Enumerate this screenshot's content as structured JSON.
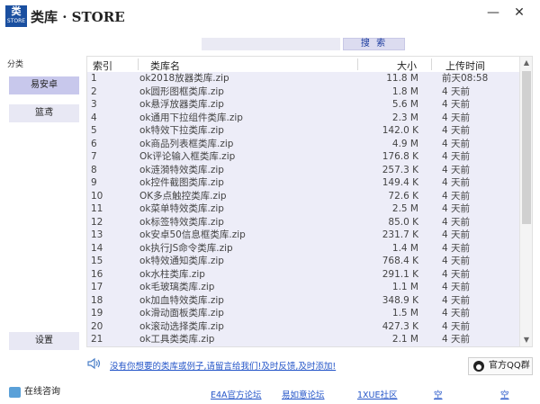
{
  "app": {
    "logo_text": "类",
    "logo_sub": "STORE",
    "title": "类库 · STORE",
    "minimize": "—",
    "close": "✕"
  },
  "search": {
    "value": "",
    "placeholder": "",
    "button_label": "搜 索"
  },
  "sidebar": {
    "category_label": "分类",
    "items": [
      {
        "label": "易安卓",
        "active": true
      },
      {
        "label": "篮鸢",
        "active": false
      }
    ],
    "settings_label": "设置"
  },
  "table": {
    "columns": [
      "索引",
      "类库名",
      "大小",
      "上传时间"
    ],
    "rows": [
      [
        "1",
        "ok2018放器类库.zip",
        "11.8 M",
        "前天08:58"
      ],
      [
        "2",
        "ok圆形图框类库.zip",
        "1.8 M",
        "4 天前"
      ],
      [
        "3",
        "ok悬浮放器类库.zip",
        "5.6 M",
        "4 天前"
      ],
      [
        "4",
        "ok通用下拉组件类库.zip",
        "2.3 M",
        "4 天前"
      ],
      [
        "5",
        "ok特效下拉类库.zip",
        "142.0 K",
        "4 天前"
      ],
      [
        "6",
        "ok商品列表框类库.zip",
        "4.9 M",
        "4 天前"
      ],
      [
        "7",
        "Ok评论输入框类库.zip",
        "176.8 K",
        "4 天前"
      ],
      [
        "8",
        "ok涟漪特效类库.zip",
        "257.3 K",
        "4 天前"
      ],
      [
        "9",
        "ok控件截图类库.zip",
        "149.4 K",
        "4 天前"
      ],
      [
        "10",
        "OK多点触控类库.zip",
        "72.6 K",
        "4 天前"
      ],
      [
        "11",
        "ok菜单特效类库.zip",
        "2.5 M",
        "4 天前"
      ],
      [
        "12",
        "ok标签特效类库.zip",
        "85.0 K",
        "4 天前"
      ],
      [
        "13",
        "ok安卓50信息框类库.zip",
        "231.7 K",
        "4 天前"
      ],
      [
        "14",
        "ok执行JS命令类库.zip",
        "1.4 M",
        "4 天前"
      ],
      [
        "15",
        "ok特效通知类库.zip",
        "768.4 K",
        "4 天前"
      ],
      [
        "16",
        "ok水柱类库.zip",
        "291.1 K",
        "4 天前"
      ],
      [
        "17",
        "ok毛玻璃类库.zip",
        "1.1 M",
        "4 天前"
      ],
      [
        "18",
        "ok加血特效类库.zip",
        "348.9 K",
        "4 天前"
      ],
      [
        "19",
        "ok滑动面板类库.zip",
        "1.5 M",
        "4 天前"
      ],
      [
        "20",
        "ok滚动选择类库.zip",
        "427.3 K",
        "4 天前"
      ],
      [
        "21",
        "ok工具类类库.zip",
        "2.1 M",
        "4 天前"
      ]
    ]
  },
  "notice": {
    "text": "没有你想要的类库或例子,请留言给我们!及时反馈,及时添加!"
  },
  "qq_group": {
    "label": "官方QQ群"
  },
  "footer": {
    "online_label": "在线咨询",
    "links": [
      "E4A官方论坛",
      "易如意论坛",
      "1XUE社区",
      "空",
      "空"
    ]
  },
  "colors": {
    "table_bg": "#ededf8",
    "link": "#2455c8",
    "active_side": "#c8c8ec"
  }
}
